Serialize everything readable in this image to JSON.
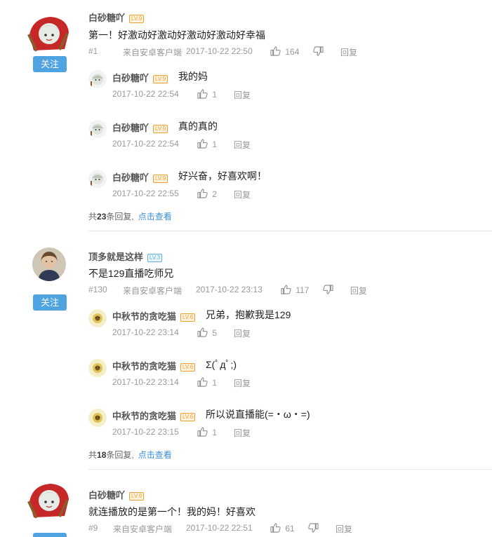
{
  "colors": {
    "accent": "#4fa3e0",
    "link": "#3b8fd6",
    "level_orange": "#f0a030",
    "level_blue": "#5fb0e0"
  },
  "comments": [
    {
      "user": "白砂糖吖",
      "level": "LV.9",
      "follow_label": "关注",
      "text": "第一！好激动好激动好激动好激动好幸福",
      "floor": "#1",
      "source": "来自安卓客户端",
      "time": "2017-10-22 22:50",
      "likes": "164",
      "reply_label": "回复",
      "replies": [
        {
          "user": "白砂糖吖",
          "level": "LV.9",
          "text": "我的妈",
          "time": "2017-10-22 22:54",
          "likes": "1",
          "reply_label": "回复"
        },
        {
          "user": "白砂糖吖",
          "level": "LV.9",
          "text": "真的真的",
          "time": "2017-10-22 22:54",
          "likes": "1",
          "reply_label": "回复"
        },
        {
          "user": "白砂糖吖",
          "level": "LV.9",
          "text": "好兴奋，好喜欢啊！",
          "time": "2017-10-22 22:55",
          "likes": "2",
          "reply_label": "回复"
        }
      ],
      "summary_prefix": "共",
      "summary_count": "23",
      "summary_suffix": "条回复,",
      "summary_link": "点击查看"
    },
    {
      "user": "顶多就是这样",
      "level": "LV.3",
      "follow_label": "关注",
      "text": "不是129直播吃师兄",
      "floor": "#130",
      "source": "来自安卓客户端",
      "time": "2017-10-22 23:13",
      "likes": "117",
      "reply_label": "回复",
      "replies": [
        {
          "user": "中秋节的贪吃猫",
          "level": "LV.6",
          "text": "兄弟，抱歉我是129",
          "time": "2017-10-22 23:14",
          "likes": "5",
          "reply_label": "回复"
        },
        {
          "user": "中秋节的贪吃猫",
          "level": "LV.6",
          "text": "Σ(ﾟдﾟ;)",
          "time": "2017-10-22 23:14",
          "likes": "1",
          "reply_label": "回复"
        },
        {
          "user": "中秋节的贪吃猫",
          "level": "LV.6",
          "text": "所以说直播能(=・ω・=)",
          "time": "2017-10-22 23:15",
          "likes": "1",
          "reply_label": "回复"
        }
      ],
      "summary_prefix": "共",
      "summary_count": "18",
      "summary_suffix": "条回复,",
      "summary_link": "点击查看"
    },
    {
      "user": "白砂糖吖",
      "level": "LV.9",
      "text": "就连播放的是第一个！我的妈！好喜欢",
      "floor": "#9",
      "source": "来自安卓客户端",
      "time": "2017-10-22 22:51",
      "likes": "61",
      "reply_label": "回复"
    }
  ]
}
